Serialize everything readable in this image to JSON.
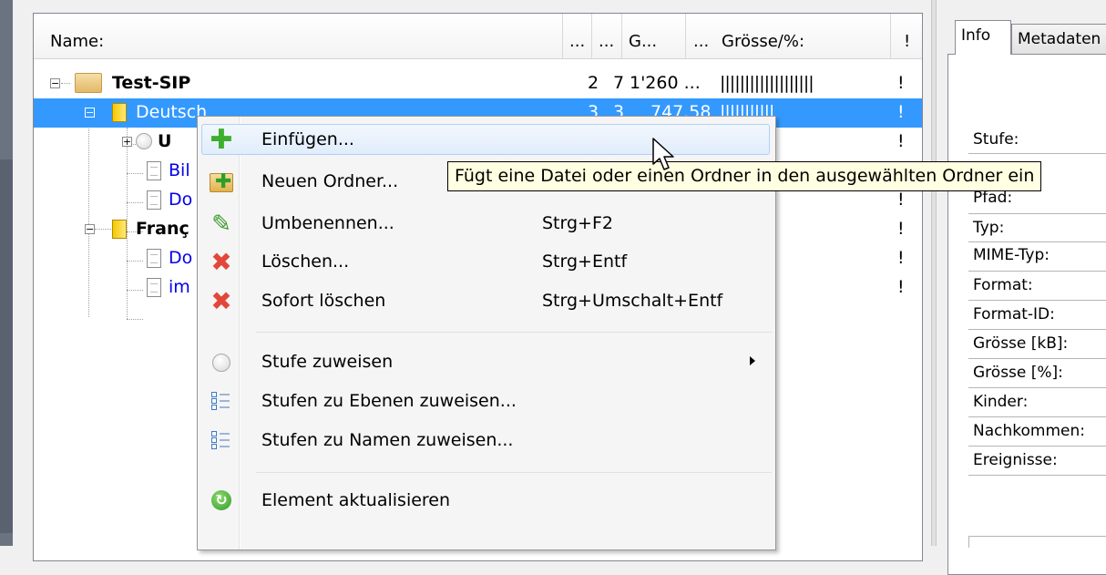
{
  "tree": {
    "columns": [
      "Name:",
      "...",
      "...",
      "G...",
      "...",
      "Grösse/%:",
      "!"
    ],
    "rows": [
      {
        "name": "Test-SIP",
        "c1": "2",
        "c2": "7",
        "c3": "1'260 ...",
        "bar": "|||||||||||||||||||",
        "flag": "!"
      },
      {
        "name": "Deutsch",
        "c1": "3",
        "c2": "3",
        "c3": "747.58",
        "bar": "|||||||||||",
        "flag": "!"
      },
      {
        "name": "U",
        "flag": "!"
      },
      {
        "name": "Bil",
        "flag": ""
      },
      {
        "name": "Do",
        "flag": "!"
      },
      {
        "name": "Franç",
        "flag": "!"
      },
      {
        "name": "Do",
        "flag": "!"
      },
      {
        "name": "im",
        "flag": "!"
      }
    ]
  },
  "context_menu": {
    "items": [
      {
        "label": "Einfügen...",
        "shortcut": "",
        "icon": "add-plus-icon"
      },
      {
        "label": "Neuen Ordner...",
        "shortcut": "",
        "icon": "new-folder-icon"
      },
      {
        "label": "Umbenennen...",
        "shortcut": "Strg+F2",
        "icon": "pencil-icon"
      },
      {
        "label": "Löschen...",
        "shortcut": "Strg+Entf",
        "icon": "delete-x-icon"
      },
      {
        "label": "Sofort löschen",
        "shortcut": "Strg+Umschalt+Entf",
        "icon": "delete-x-icon"
      },
      {
        "label": "Stufe zuweisen",
        "shortcut": "",
        "icon": "circle-icon"
      },
      {
        "label": "Stufen zu Ebenen zuweisen...",
        "shortcut": "",
        "icon": "list-icon"
      },
      {
        "label": "Stufen zu Namen zuweisen...",
        "shortcut": "",
        "icon": "list-icon"
      },
      {
        "label": "Element aktualisieren",
        "shortcut": "",
        "icon": "refresh-icon"
      }
    ]
  },
  "tooltip": {
    "text": "Fügt eine Datei oder einen Ordner in den ausgewählten Ordner ein"
  },
  "right_panel": {
    "tabs": [
      "Info",
      "Metadaten"
    ],
    "properties": [
      "Stufe:",
      "Pfad:",
      "Typ:",
      "MIME-Typ:",
      "Format:",
      "Format-ID:",
      "Grösse [kB]:",
      "Grösse [%]:",
      "Kinder:",
      "Nachkommen:",
      "Ereignisse:"
    ]
  },
  "colors": {
    "selection": "#3399ff",
    "link": "#0000ee",
    "tooltip_bg": "#ffffe1",
    "menu_hover": "#e1edfb"
  }
}
